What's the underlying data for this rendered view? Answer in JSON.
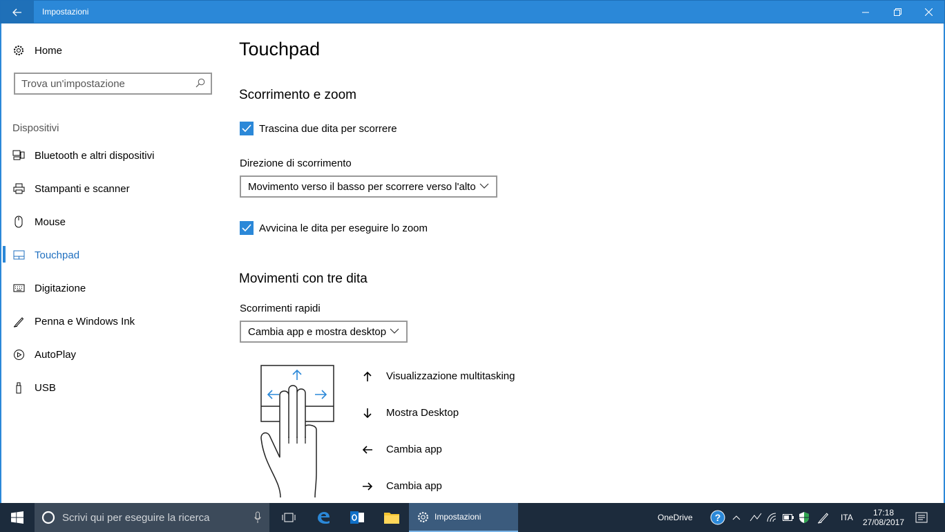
{
  "window": {
    "title": "Impostazioni"
  },
  "sidebar": {
    "home_label": "Home",
    "search_placeholder": "Trova un'impostazione",
    "section_label": "Dispositivi",
    "items": [
      {
        "label": "Bluetooth e altri dispositivi",
        "icon": "bluetooth-devices-icon"
      },
      {
        "label": "Stampanti e scanner",
        "icon": "printer-icon"
      },
      {
        "label": "Mouse",
        "icon": "mouse-icon"
      },
      {
        "label": "Touchpad",
        "icon": "touchpad-icon",
        "active": true
      },
      {
        "label": "Digitazione",
        "icon": "keyboard-icon"
      },
      {
        "label": "Penna e Windows Ink",
        "icon": "pen-icon"
      },
      {
        "label": "AutoPlay",
        "icon": "autoplay-icon"
      },
      {
        "label": "USB",
        "icon": "usb-icon"
      }
    ]
  },
  "main": {
    "title": "Touchpad",
    "scroll_section": {
      "heading": "Scorrimento e zoom",
      "two_finger_scroll_label": "Trascina due dita per scorrere",
      "two_finger_scroll_checked": true,
      "direction_label": "Direzione di scorrimento",
      "direction_value": "Movimento verso il basso per scorrere verso l'alto",
      "pinch_zoom_label": "Avvicina le dita per eseguire lo zoom",
      "pinch_zoom_checked": true
    },
    "three_finger_section": {
      "heading": "Movimenti con tre dita",
      "swipes_label": "Scorrimenti rapidi",
      "swipes_value": "Cambia app e mostra desktop",
      "gestures": [
        {
          "direction": "up",
          "label": "Visualizzazione multitasking"
        },
        {
          "direction": "down",
          "label": "Mostra Desktop"
        },
        {
          "direction": "left",
          "label": "Cambia app"
        },
        {
          "direction": "right",
          "label": "Cambia app"
        }
      ]
    }
  },
  "taskbar": {
    "search_placeholder": "Scrivi qui per eseguire la ricerca",
    "active_app_label": "Impostazioni",
    "onedrive_label": "OneDrive",
    "language": "ITA",
    "time": "17:18",
    "date": "27/08/2017"
  },
  "colors": {
    "accent": "#2b88d8",
    "taskbar": "#1c2b3c"
  }
}
